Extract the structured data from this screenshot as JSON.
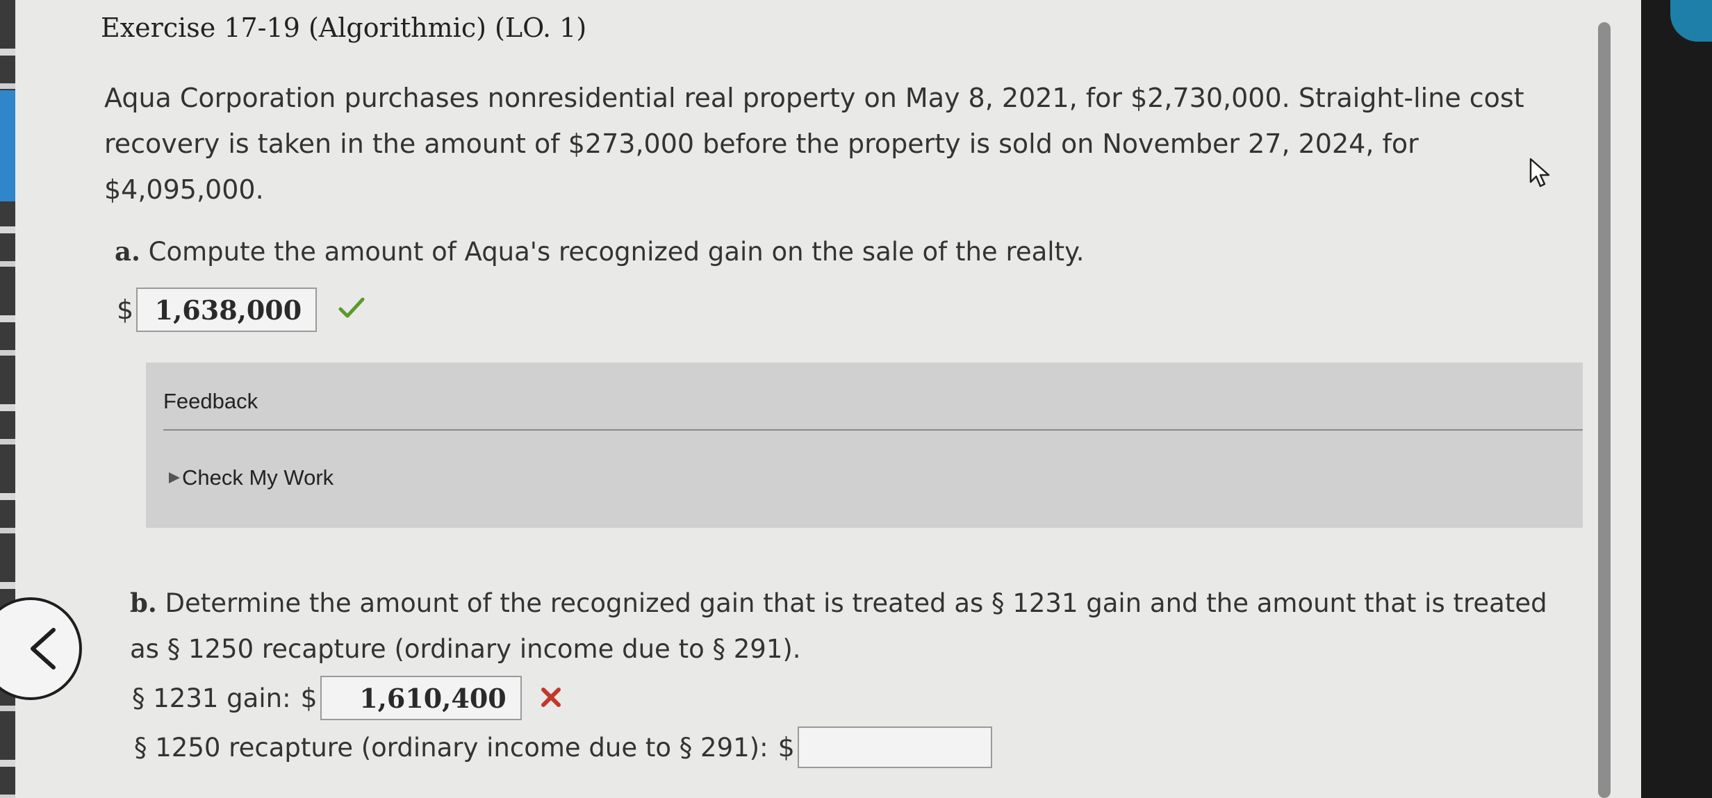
{
  "page": {
    "title": "Exercise 17-19 (Algorithmic) (LO. 1)"
  },
  "problem": {
    "line1": "Aqua Corporation purchases nonresidential real property on May 8, 2021, for $2,730,000. Straight-line cost",
    "line2": "recovery is taken in the amount of $273,000 before the property is sold on November 27, 2024, for",
    "line3": "$4,095,000."
  },
  "part_a": {
    "letter": "a.",
    "question": "Compute the amount of Aqua's recognized gain on the sale of the realty.",
    "currency": "$",
    "answer": "1,638,000",
    "status": "correct"
  },
  "feedback": {
    "label": "Feedback",
    "check_my_work": "Check My Work"
  },
  "part_b": {
    "letter": "b.",
    "question_line1": "Determine the amount of the recognized gain that is treated as § 1231 gain and the amount that is treated",
    "question_line2": "as § 1250 recapture (ordinary income due to § 291).",
    "gain_1231_label": "§ 1231 gain:",
    "gain_1231_currency": "$",
    "gain_1231_value": "1,610,400",
    "gain_1231_status": "incorrect",
    "recapture_1250_label": "§ 1250 recapture (ordinary income due to § 291):",
    "recapture_1250_currency": "$",
    "recapture_1250_value": ""
  },
  "colors": {
    "correct": "#5a9a2a",
    "incorrect": "#c0392b",
    "feedback_bg": "#cfd0cf"
  },
  "icons": [
    "chevron-left-icon",
    "checkmark-icon",
    "x-mark-icon",
    "triangle-right-icon",
    "mouse-cursor-icon"
  ]
}
